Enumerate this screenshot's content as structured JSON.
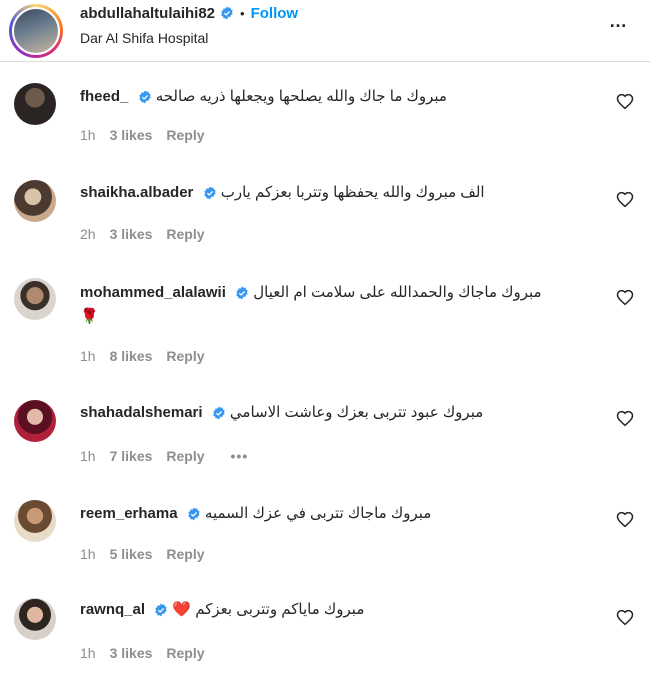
{
  "post_header": {
    "username": "abdullahaltulaihi82",
    "separator": "•",
    "follow_label": "Follow",
    "location": "Dar Al Shifa Hospital",
    "more_icon": "…"
  },
  "colors": {
    "link": "#0095f6",
    "verified": "#3897f0",
    "muted": "#8e8e8e"
  },
  "comments": [
    {
      "username": "fheed_",
      "text": "مبروك ما جاك والله يصلحها ويجعلها ذريه صالحه",
      "time": "1h",
      "likes": "3 likes",
      "reply": "Reply"
    },
    {
      "username": "shaikha.albader",
      "text": "الف مبروك والله يحفظها وتتربا بعزكم يارب",
      "time": "2h",
      "likes": "3 likes",
      "reply": "Reply"
    },
    {
      "username": "mohammed_alalawii",
      "text": "مبروك ماجاك والحمدالله على سلامت ام العيال 🌹",
      "time": "1h",
      "likes": "8 likes",
      "reply": "Reply"
    },
    {
      "username": "shahadalshemari",
      "text": "مبروك عبود تتربى بعزك وعاشت الاسامي",
      "time": "1h",
      "likes": "7 likes",
      "reply": "Reply",
      "more": "•••"
    },
    {
      "username": "reem_erhama",
      "text": "مبروك ماجاك تتربى في عزك السميه",
      "time": "1h",
      "likes": "5 likes",
      "reply": "Reply"
    },
    {
      "username": "rawnq_al",
      "text": "مبروك ماياكم وتتربى بعزكم ❤️",
      "time": "1h",
      "likes": "3 likes",
      "reply": "Reply"
    }
  ]
}
